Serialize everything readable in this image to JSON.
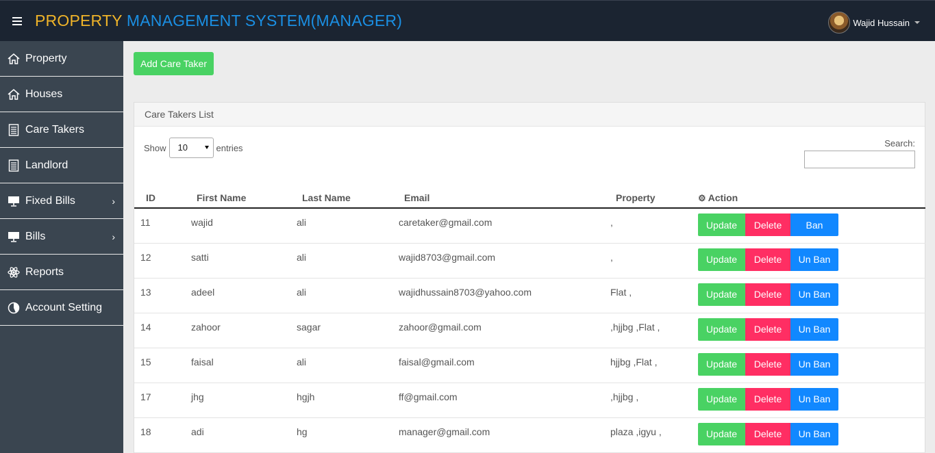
{
  "header": {
    "brand_part1": "PROPERTY",
    "brand_part2": "MANAGEMENT SYSTEM(MANAGER)",
    "user_name": "Wajid Hussain"
  },
  "sidebar": {
    "items": [
      {
        "label": "Property",
        "icon": "home-icon"
      },
      {
        "label": "Houses",
        "icon": "home-icon"
      },
      {
        "label": "Care Takers",
        "icon": "document-icon"
      },
      {
        "label": "Landlord",
        "icon": "document-icon"
      },
      {
        "label": "Fixed Bills",
        "icon": "monitor-icon",
        "chevron": "›"
      },
      {
        "label": "Bills",
        "icon": "monitor-icon",
        "chevron": "›"
      },
      {
        "label": "Reports",
        "icon": "atom-icon"
      },
      {
        "label": "Account Setting",
        "icon": "pie-chart-icon"
      }
    ]
  },
  "main": {
    "add_button": "Add Care Taker",
    "panel_title": "Care Takers List",
    "show_label": "Show",
    "page_length": "10",
    "entries_label": "entries",
    "search_label": "Search:",
    "search_value": ""
  },
  "table": {
    "headers": [
      "ID",
      "First Name",
      "Last Name",
      "Email",
      "Property",
      "Action"
    ],
    "rows": [
      {
        "id": "11",
        "first": "wajid",
        "last": "ali",
        "email": "caretaker@gmail.com",
        "property": ",",
        "update": "Update",
        "delete": "Delete",
        "ban": "Ban"
      },
      {
        "id": "12",
        "first": "satti",
        "last": "ali",
        "email": "wajid8703@gmail.com",
        "property": ",",
        "update": "Update",
        "delete": "Delete",
        "ban": "Un Ban"
      },
      {
        "id": "13",
        "first": "adeel",
        "last": "ali",
        "email": "wajidhussain8703@yahoo.com",
        "property": "Flat ,",
        "update": "Update",
        "delete": "Delete",
        "ban": "Un Ban"
      },
      {
        "id": "14",
        "first": "zahoor",
        "last": "sagar",
        "email": "zahoor@gmail.com",
        "property": ",hjjbg ,Flat ,",
        "update": "Update",
        "delete": "Delete",
        "ban": "Un Ban"
      },
      {
        "id": "15",
        "first": "faisal",
        "last": "ali",
        "email": "faisal@gmail.com",
        "property": "hjjbg ,Flat ,",
        "update": "Update",
        "delete": "Delete",
        "ban": "Un Ban"
      },
      {
        "id": "17",
        "first": "jhg",
        "last": "hgjh",
        "email": "ff@gmail.com",
        "property": ",hjjbg ,",
        "update": "Update",
        "delete": "Delete",
        "ban": "Un Ban"
      },
      {
        "id": "18",
        "first": "adi",
        "last": "hg",
        "email": "manager@gmail.com",
        "property": "plaza ,igyu ,",
        "update": "Update",
        "delete": "Delete",
        "ban": "Un Ban"
      }
    ]
  },
  "colors": {
    "topbar": "#1b2431",
    "brand_gold": "#f0b429",
    "brand_blue": "#1b8fe3",
    "sidebar": "#3a4550",
    "success": "#49d263",
    "danger": "#ff2e63",
    "primary": "#1188ff"
  }
}
